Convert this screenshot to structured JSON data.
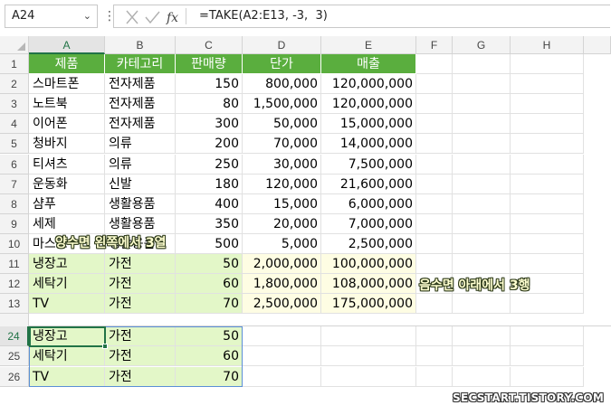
{
  "name_box": "A24",
  "formula": "=TAKE(A2:E13, -3,  3)",
  "columns": [
    "A",
    "B",
    "C",
    "D",
    "E",
    "F",
    "G",
    "H"
  ],
  "rows_top": [
    "1",
    "2",
    "3",
    "4",
    "5",
    "6",
    "7",
    "8",
    "9",
    "10",
    "11",
    "12",
    "13"
  ],
  "rows_bottom": [
    "24",
    "25",
    "26"
  ],
  "table": {
    "header": [
      "제품",
      "카테고리",
      "판매량",
      "단가",
      "매출"
    ],
    "rows": [
      [
        "스마트폰",
        "전자제품",
        "150",
        "800,000",
        "120,000,000"
      ],
      [
        "노트북",
        "전자제품",
        "80",
        "1,500,000",
        "120,000,000"
      ],
      [
        "이어폰",
        "전자제품",
        "300",
        "50,000",
        "15,000,000"
      ],
      [
        "청바지",
        "의류",
        "200",
        "70,000",
        "14,000,000"
      ],
      [
        "티셔츠",
        "의류",
        "250",
        "30,000",
        "7,500,000"
      ],
      [
        "운동화",
        "신발",
        "180",
        "120,000",
        "21,600,000"
      ],
      [
        "샴푸",
        "생활용품",
        "400",
        "15,000",
        "6,000,000"
      ],
      [
        "세제",
        "생활용품",
        "350",
        "20,000",
        "7,000,000"
      ],
      [
        "마스크",
        "생활용품",
        "500",
        "5,000",
        "2,500,000"
      ],
      [
        "냉장고",
        "가전",
        "50",
        "2,000,000",
        "100,000,000"
      ],
      [
        "세탁기",
        "가전",
        "60",
        "1,800,000",
        "108,000,000"
      ],
      [
        "TV",
        "가전",
        "70",
        "2,500,000",
        "175,000,000"
      ]
    ]
  },
  "result": [
    [
      "냉장고",
      "가전",
      "50"
    ],
    [
      "세탁기",
      "가전",
      "60"
    ],
    [
      "TV",
      "가전",
      "70"
    ]
  ],
  "annotations": {
    "positive": "양수면 왼쪽에서 3열",
    "negative": "음수면 아래에서 3행"
  },
  "watermark": "SECSTART.TISTORY.COM",
  "colors": {
    "header_green": "#5aae3e",
    "result_green": "#e3f7c8",
    "highlight_yellow": "#fefde3",
    "selection": "#217346"
  }
}
